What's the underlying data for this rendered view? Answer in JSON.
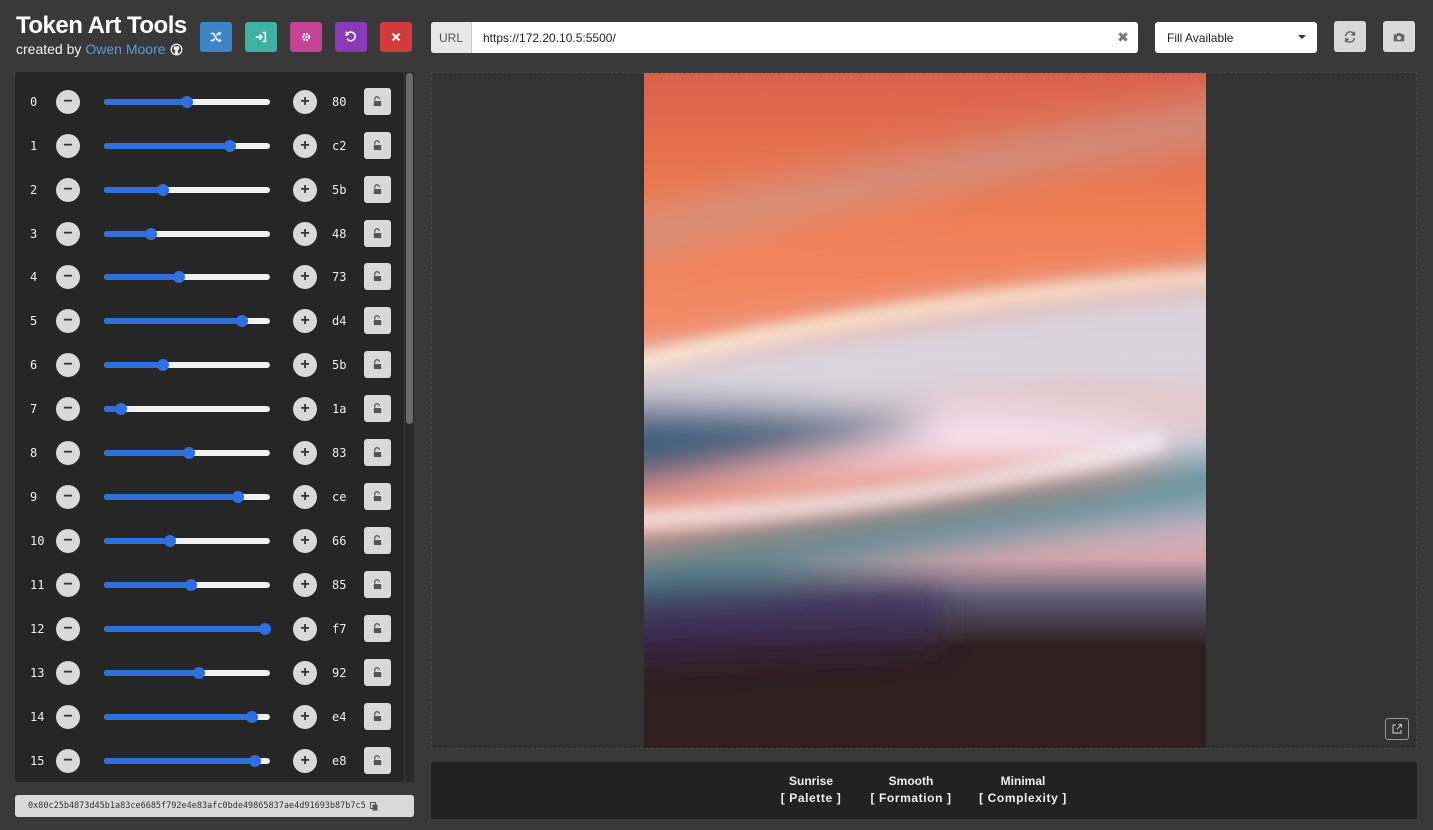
{
  "brand": {
    "title": "Token Art Tools",
    "created_by": "created by",
    "author": "Owen Moore",
    "github_icon": "github-icon"
  },
  "toolbar": {
    "buttons": [
      {
        "name": "shuffle-button",
        "icon": "shuffle-icon",
        "color": "#3d85c6"
      },
      {
        "name": "import-button",
        "icon": "sign-in-icon",
        "color": "#3fb0a2"
      },
      {
        "name": "settings-button",
        "icon": "gear-icon",
        "color": "#c34396"
      },
      {
        "name": "undo-button",
        "icon": "undo-icon",
        "color": "#8a3ab9"
      },
      {
        "name": "close-button",
        "icon": "close-icon",
        "color": "#d33b3b"
      }
    ]
  },
  "url": {
    "label": "URL",
    "value": "https://172.20.10.5:5500/"
  },
  "size_select": {
    "value": "Fill Available"
  },
  "actions": {
    "refresh_icon": "refresh-icon",
    "screenshot_icon": "camera-icon"
  },
  "sliders": [
    {
      "index": "0",
      "hex": "80",
      "value": 128
    },
    {
      "index": "1",
      "hex": "c2",
      "value": 194
    },
    {
      "index": "2",
      "hex": "5b",
      "value": 91
    },
    {
      "index": "3",
      "hex": "48",
      "value": 72
    },
    {
      "index": "4",
      "hex": "73",
      "value": 115
    },
    {
      "index": "5",
      "hex": "d4",
      "value": 212
    },
    {
      "index": "6",
      "hex": "5b",
      "value": 91
    },
    {
      "index": "7",
      "hex": "1a",
      "value": 26
    },
    {
      "index": "8",
      "hex": "83",
      "value": 131
    },
    {
      "index": "9",
      "hex": "ce",
      "value": 206
    },
    {
      "index": "10",
      "hex": "66",
      "value": 102
    },
    {
      "index": "11",
      "hex": "85",
      "value": 133
    },
    {
      "index": "12",
      "hex": "f7",
      "value": 247
    },
    {
      "index": "13",
      "hex": "92",
      "value": 146
    },
    {
      "index": "14",
      "hex": "e4",
      "value": 228
    },
    {
      "index": "15",
      "hex": "e8",
      "value": 232
    }
  ],
  "hash": {
    "value": "0x80c25b4873d45b1a83ce6685f792e4e83afc0bde49865837ae4d91693b87b7c5"
  },
  "features": [
    {
      "name": "Sunrise",
      "category": "[ Palette ]"
    },
    {
      "name": "Smooth",
      "category": "[ Formation ]"
    },
    {
      "name": "Minimal",
      "category": "[ Complexity ]"
    }
  ],
  "colors": {
    "accent": "#2f6fde",
    "panel": "#262626",
    "background": "#393939",
    "link": "#5b9bd5"
  }
}
